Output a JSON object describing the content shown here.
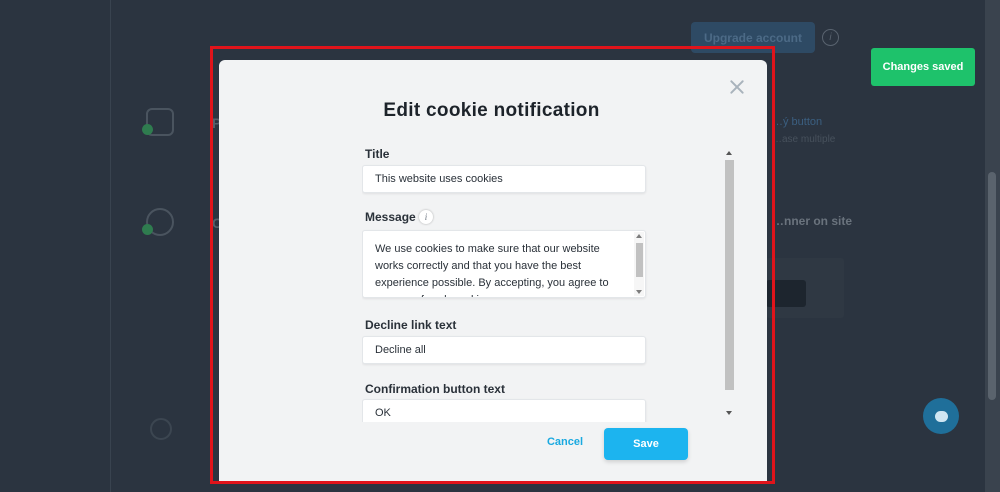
{
  "background": {
    "upgrade_label": "Upgrade account",
    "info_glyph": "i",
    "letter_p": "P",
    "letter_c": "C",
    "link_text": "…ý button",
    "sub_text": "…ase multiple",
    "banner_text": "…nner on site",
    "dark_button_glyph": "C"
  },
  "toast": {
    "text": "Changes saved",
    "color": "#1ec26b"
  },
  "modal": {
    "title": "Edit cookie notification",
    "close_icon": "close-icon",
    "fields": {
      "title_label": "Title",
      "title_value": "This website uses cookies",
      "message_label": "Message",
      "message_info_glyph": "i",
      "message_value": "We use cookies to make sure that our website works correctly and that you have the best experience possible. By accepting, you agree to our use of such cookies.",
      "decline_label": "Decline link text",
      "decline_value": "Decline all",
      "confirm_label": "Confirmation button text",
      "confirm_value": "OK"
    },
    "cancel_label": "Cancel",
    "save_label": "Save",
    "accent_color": "#1cb4ef"
  },
  "highlight_color": "#e0141b"
}
